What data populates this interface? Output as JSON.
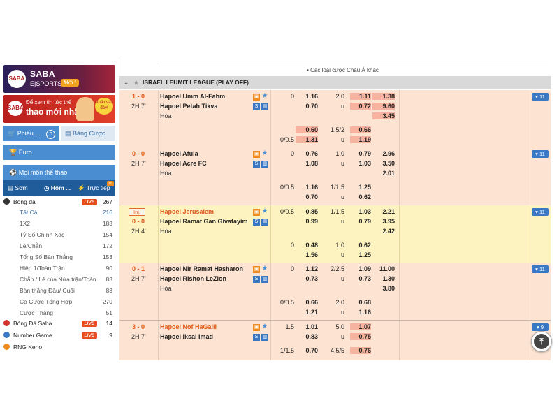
{
  "sidebar": {
    "banner1": {
      "logo": "SABA",
      "title": "SABA",
      "sub": "E|SPORTS",
      "badge": "Mới !"
    },
    "banner2": {
      "logo": "SABA",
      "line1": "Để xem tin tức thể",
      "line2": "thao mới nhất",
      "tag": "Nhấn vào đây!"
    },
    "slip_label": "Phiếu ...",
    "slip_count": "0",
    "table_label": "Bảng Cược",
    "euro": "Euro",
    "all_sports": "Mọi môn thể thao",
    "tabs": {
      "early": "Sớm",
      "today": "Hôm ...",
      "live": "Trực tiếp",
      "new_badge": "86"
    },
    "sports": [
      {
        "name": "Bóng đá",
        "live": "LIVE",
        "count": "267"
      },
      {
        "name": "Bóng Đá Saba",
        "live": "LIVE",
        "count": "14"
      },
      {
        "name": "Number Game",
        "live": "LIVE",
        "count": "9"
      },
      {
        "name": "RNG Keno",
        "live": "",
        "count": ""
      }
    ],
    "football_sub": [
      {
        "name": "Tất Cả",
        "count": "216"
      },
      {
        "name": "1X2",
        "count": "183"
      },
      {
        "name": "Tỷ Số Chính Xác",
        "count": "154"
      },
      {
        "name": "Lẻ/Chẵn",
        "count": "172"
      },
      {
        "name": "Tổng Số Bàn Thắng",
        "count": "153"
      },
      {
        "name": "Hiệp 1/Toàn Trận",
        "count": "90"
      },
      {
        "name": "Chẵn / Lẻ của Nửa trận/Toàn",
        "count": "83"
      },
      {
        "name": "Bàn thắng Đầu/ Cuối",
        "count": "83"
      },
      {
        "name": "Cá Cược Tổng Hợp",
        "count": "270"
      },
      {
        "name": "Cược Thắng",
        "count": "51"
      }
    ]
  },
  "main": {
    "header_text": "• Các loại cược Châu Á khác",
    "league": "ISRAEL LEUMIT LEAGUE (PLAY OFF)",
    "draw_label": "Hòa",
    "matches": [
      {
        "score": "1 - 0",
        "time": "2H 7'",
        "inj": "",
        "home": "Hapoel Umm Al-Fahm",
        "away": "Hapoel Petah Tikva",
        "more": "▾ 11",
        "hdp1": "0",
        "h1": "1.16",
        "a1": "0.70",
        "ou1": "2.0",
        "u1": "u",
        "o1": "1.11",
        "o2": "0.72",
        "x1": "1.38",
        "x2": "9.60",
        "x3": "3.45",
        "hdp2": "0/0.5",
        "h2": "0.60",
        "a2": "1.31",
        "ou2": "1.5/2",
        "u2": "u",
        "o3": "0.66",
        "o4": "1.19"
      },
      {
        "score": "0 - 0",
        "time": "2H 7'",
        "inj": "",
        "home": "Hapoel Afula",
        "away": "Hapoel Acre FC",
        "more": "▾ 11",
        "hdp1": "0",
        "h1": "0.76",
        "a1": "1.08",
        "ou1": "1.0",
        "u1": "u",
        "o1": "0.79",
        "o2": "1.03",
        "x1": "2.96",
        "x2": "3.50",
        "x3": "2.01",
        "hdp2": "0/0.5",
        "h2": "1.16",
        "a2": "0.70",
        "ou2": "1/1.5",
        "u2": "u",
        "o3": "1.25",
        "o4": "0.62"
      },
      {
        "score": "0 - 0",
        "time": "2H 4'",
        "inj": "Inj.",
        "home": "Hapoel Jerusalem",
        "away": "Hapoel Ramat Gan Givatayim",
        "more": "▾ 11",
        "hdp1": "0/0.5",
        "h1": "0.85",
        "a1": "0.99",
        "ou1": "1/1.5",
        "u1": "u",
        "o1": "1.03",
        "o2": "0.79",
        "x1": "2.21",
        "x2": "3.95",
        "x3": "2.42",
        "hdp2": "0",
        "h2": "0.48",
        "a2": "1.56",
        "ou2": "1.0",
        "u2": "u",
        "o3": "0.62",
        "o4": "1.25"
      },
      {
        "score": "0 - 1",
        "time": "2H 7'",
        "inj": "",
        "home": "Hapoel Nir Ramat Hasharon",
        "away": "Hapoel Rishon LeZion",
        "more": "▾ 11",
        "hdp1": "0",
        "h1": "1.12",
        "a1": "0.73",
        "ou1": "2/2.5",
        "u1": "u",
        "o1": "1.09",
        "o2": "0.73",
        "x1": "11.00",
        "x2": "1.30",
        "x3": "3.80",
        "hdp2": "0/0.5",
        "h2": "0.66",
        "a2": "1.21",
        "ou2": "2.0",
        "u2": "u",
        "o3": "0.68",
        "o4": "1.16"
      },
      {
        "score": "3 - 0",
        "time": "2H 7'",
        "inj": "",
        "home": "Hapoel Nof HaGalil",
        "away": "Hapoel Iksal Imad",
        "more": "▾ 9",
        "hdp1": "1.5",
        "h1": "1.01",
        "a1": "0.83",
        "ou1": "5.0",
        "u1": "u",
        "o1": "1.07",
        "o2": "0.75",
        "x1": "",
        "x2": "",
        "x3": "",
        "hdp2": "1/1.5",
        "h2": "0.70",
        "a2": "",
        "ou2": "4.5/5",
        "u2": "",
        "o3": "0.76",
        "o4": ""
      }
    ]
  },
  "colors": {
    "accent": "#4a8ed1",
    "score": "#e05a1a",
    "row": "#fce3d2",
    "row_highlight": "#fdf3c0"
  },
  "icons": [
    "trophy-icon",
    "star-icon",
    "stats-icon",
    "scroll-top-icon"
  ]
}
